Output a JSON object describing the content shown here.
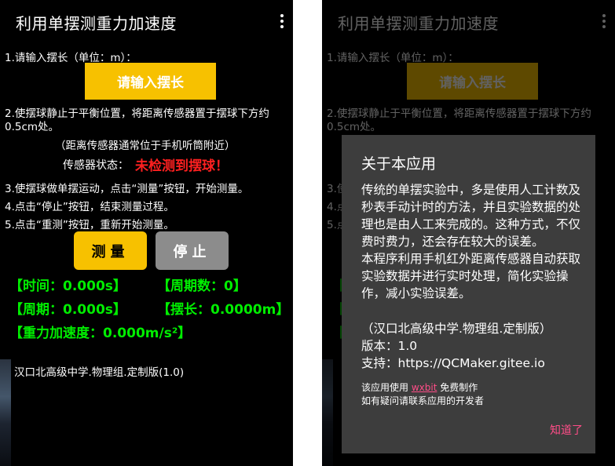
{
  "app": {
    "title": "利用单摆测重力加速度",
    "menu_icon": "more-vert-icon"
  },
  "steps": {
    "step1": "1.请输入摆长（单位：m）：",
    "input_button": "请输入摆长",
    "step2_line1": "2.使摆球静止于平衡位置，将距离传感器置于摆球下方约",
    "step2_line2": "0.5cm处。",
    "note": "（距离传感器通常位于手机听筒附近）",
    "sensor_label": "传感器状态：",
    "sensor_status": "未检测到摆球！",
    "step3": "3.使摆球做单摆运动，点击“测量”按钮，开始测量。",
    "step4": "4.点击“停止”按钮，结束测量过程。",
    "step5": "5.点击“重测”按钮，重新开始测量。"
  },
  "buttons": {
    "measure": "测量",
    "stop": "停止"
  },
  "stats": {
    "time": "【时间：0.000s】",
    "count": "【周期数：0】",
    "period": "【周期：0.000s】",
    "length": "【摆长：0.0000m】",
    "gravity": "【重力加速度：0.000m/s²】"
  },
  "footer": "汉口北高级中学.物理组.定制版(1.0)",
  "dialog": {
    "title": "关于本应用",
    "para1": "传统的单摆实验中，多是使用人工计数及秒表手动计时的方法，并且实验数据的处理也是由人工来完成的。这种方式，不仅费时费力，还会存在较大的误差。",
    "para2": "本程序利用手机红外距离传感器自动获取实验数据并进行实时处理，简化实验操作，减小实验误差。",
    "edition": "（汉口北高级中学.物理组.定制版）",
    "version": "版本：1.0",
    "support": "支持：https://QCMaker.gitee.io",
    "made_prefix": "该应用使用 ",
    "made_link": "wxbit",
    "made_suffix": " 免费制作",
    "contact": "如有疑问请联系应用的开发者",
    "ok": "知道了"
  },
  "colors": {
    "accent_yellow": "#f7c100",
    "stat_green": "#00ee00",
    "status_red": "#ff2020",
    "stop_gray": "#8c8c8c",
    "dialog_bg": "#3d3d3d",
    "link_pink": "#ff4d88"
  }
}
